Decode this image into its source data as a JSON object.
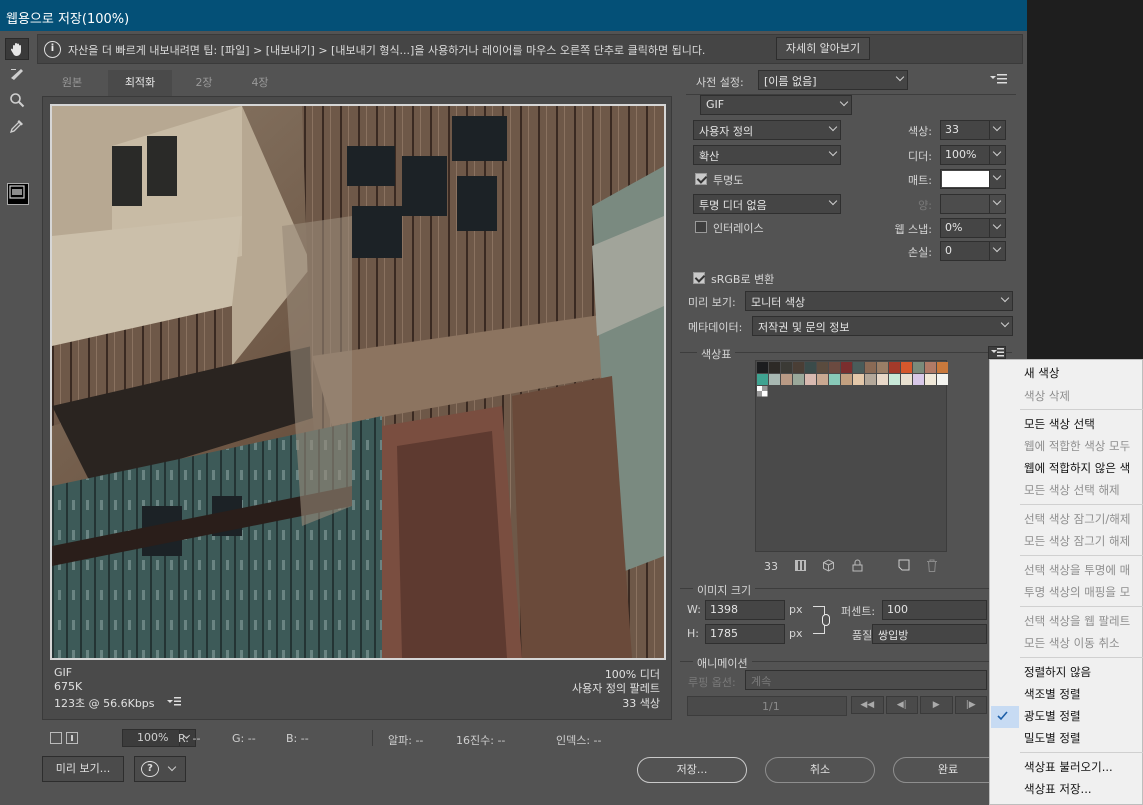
{
  "window": {
    "title": "웹용으로 저장(100%)"
  },
  "tip": {
    "text": "자산을 더 빠르게 내보내려면 팁: [파일] > [내보내기] > [내보내기 형식...]을 사용하거나 레이어를 마우스 오른쪽 단추로 클릭하면 됩니다.",
    "learn_more": "자세히 알아보기",
    "icon": "info-icon"
  },
  "tabs": [
    {
      "label": "원본"
    },
    {
      "label": "최적화"
    },
    {
      "label": "2장"
    },
    {
      "label": "4장"
    }
  ],
  "image_info": {
    "format": "GIF",
    "size": "675K",
    "time": "123초 @ 56.6Kbps",
    "dither": "100% 디더",
    "palette": "사용자 정의 팔레트",
    "colors": "33 색상"
  },
  "status": {
    "zoom": "100%",
    "r": "R: --",
    "g": "G: --",
    "b": "B: --",
    "alpha": "알파: --",
    "hex": "16진수: --",
    "index": "인덱스: --"
  },
  "buttons": {
    "preview": "미리 보기...",
    "save": "저장...",
    "cancel": "취소",
    "done": "완료"
  },
  "settings": {
    "preset_label": "사전 설정:",
    "preset_value": "[이름 없음]",
    "format": "GIF",
    "reduction": "사용자 정의",
    "dither_algo": "확산",
    "transparency": "투명도",
    "transparency_dither": "투명 디더 없음",
    "interlace": "인터레이스",
    "colors_label": "색상:",
    "colors_value": "33",
    "dither_label": "디더:",
    "dither_value": "100%",
    "matte_label": "매트:",
    "amount_label": "양:",
    "websnap_label": "웹 스냅:",
    "websnap_value": "0%",
    "lossy_label": "손실:",
    "lossy_value": "0",
    "srgb": "sRGB로 변환",
    "preview_label": "미리 보기:",
    "preview_value": "모니터 색상",
    "metadata_label": "메타데이터:",
    "metadata_value": "저작권 및 문의 정보"
  },
  "color_table": {
    "title": "색상표",
    "count": "33",
    "swatches": [
      "#1c1d1f",
      "#2d2a26",
      "#3b3a35",
      "#4a3e35",
      "#3a4b4a",
      "#5a4b3e",
      "#6b4a40",
      "#7a2e2e",
      "#4a5c5a",
      "#8a6a55",
      "#9a7e66",
      "#a33a2a",
      "#d4582c",
      "#7a8a7a",
      "#b07a66",
      "#c9793c",
      "#3fa391",
      "#a8b8b2",
      "#b99a85",
      "#9aa89a",
      "#d8b9b0",
      "#c9a891",
      "#88c9b8",
      "#c2a080",
      "#e3c7a9",
      "#b4a89a",
      "#e8d8c8",
      "#c8e8d8",
      "#e8e0d0",
      "#d8c8e8",
      "#f0e8d8",
      "#f4f4f0"
    ]
  },
  "image_size": {
    "title": "이미지 크기",
    "w_label": "W:",
    "w_value": "1398",
    "h_label": "H:",
    "h_value": "1785",
    "unit": "px",
    "percent_label": "퍼센트:",
    "percent_value": "100",
    "quality_label": "품질:",
    "quality_value": "쌍입방"
  },
  "animation": {
    "title": "애니메이션",
    "loop_label": "루핑 옵션:",
    "loop_value": "계속",
    "frame": "1/1"
  },
  "menu": {
    "items": [
      {
        "label": "새 색상",
        "enabled": true
      },
      {
        "label": "색상 삭제",
        "enabled": false
      },
      {
        "label": "모든 색상 선택",
        "enabled": true
      },
      {
        "label": "웹에 적합한 색상 모두",
        "enabled": false
      },
      {
        "label": "웹에 적합하지 않은 색",
        "enabled": true
      },
      {
        "label": "모든 색상 선택 해제",
        "enabled": false
      },
      {
        "label": "선택 색상 잠그기/해제",
        "enabled": false
      },
      {
        "label": "모든 색상 잠그기 해제",
        "enabled": false
      },
      {
        "label": "선택 색상을 투명에 매",
        "enabled": false
      },
      {
        "label": "투명 색상의 매핑을 모",
        "enabled": false
      },
      {
        "label": "선택 색상을 웹 팔레트",
        "enabled": false
      },
      {
        "label": "모든 색상 이동 취소",
        "enabled": false
      },
      {
        "label": "정렬하지 않음",
        "enabled": true
      },
      {
        "label": "색조별 정렬",
        "enabled": true
      },
      {
        "label": "광도별 정렬",
        "enabled": true,
        "checked": true
      },
      {
        "label": "밀도별 정렬",
        "enabled": true
      },
      {
        "label": "색상표 불러오기...",
        "enabled": true
      },
      {
        "label": "색상표 저장...",
        "enabled": true
      }
    ]
  }
}
